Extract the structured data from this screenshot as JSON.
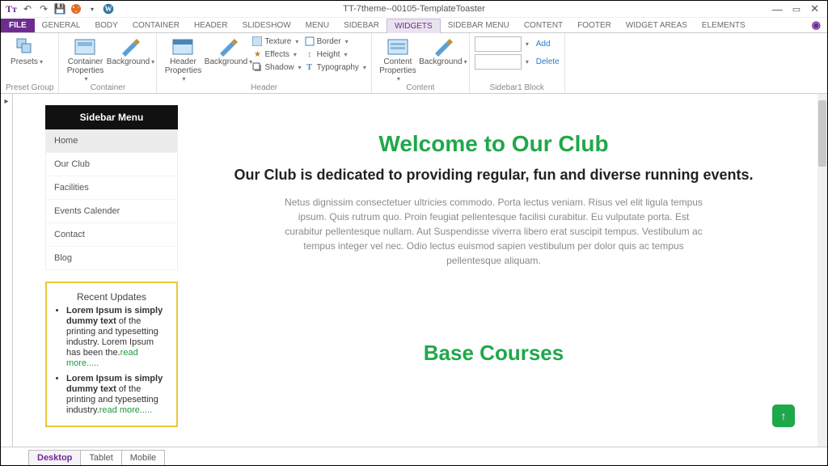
{
  "title": "TT-7theme--00105-TemplateToaster",
  "tabs": {
    "file": "FILE",
    "items": [
      "GENERAL",
      "BODY",
      "CONTAINER",
      "HEADER",
      "SLIDESHOW",
      "MENU",
      "SIDEBAR",
      "WIDGETS",
      "SIDEBAR MENU",
      "CONTENT",
      "FOOTER",
      "WIDGET AREAS",
      "ELEMENTS"
    ],
    "active_index": 7
  },
  "ribbon": {
    "preset_group": {
      "label": "Preset Group",
      "presets": "Presets"
    },
    "container": {
      "label": "Container",
      "props": "Container\nProperties",
      "bg": "Background"
    },
    "header": {
      "label": "Header",
      "props": "Header\nProperties",
      "bg": "Background",
      "texture": "Texture",
      "effects": "Effects",
      "shadow": "Shadow",
      "border": "Border",
      "height": "Height",
      "typo": "Typography"
    },
    "content": {
      "label": "Content",
      "props": "Content\nProperties",
      "bg": "Background"
    },
    "sidebar": {
      "label": "Sidebar1 Block",
      "add": "Add",
      "delete": "Delete"
    }
  },
  "sidebar_menu": {
    "title": "Sidebar Menu",
    "items": [
      "Home",
      "Our Club",
      "Facilities",
      "Events Calender",
      "Contact",
      "Blog"
    ]
  },
  "recent_updates": {
    "title": "Recent Updates",
    "items": [
      {
        "bold": "Lorem Ipsum is simply dummy text",
        "rest": " of the printing and typesetting industry. Lorem Ipsum has been the.",
        "link": "read more....."
      },
      {
        "bold": "Lorem Ipsum is simply dummy text",
        "rest": " of the printing and typesetting industry.",
        "link": "read more....."
      }
    ]
  },
  "page": {
    "h1": "Welcome to Our Club",
    "h2": "Our Club is dedicated to providing regular, fun and diverse running events.",
    "body": "Netus dignissim consectetuer ultricies commodo. Porta lectus veniam. Risus vel elit ligula tempus ipsum. Quis rutrum quo. Proin feugiat pellentesque facilisi curabitur. Eu vulputate porta. Est curabitur pellentesque nullam. Aut Suspendisse viverra libero erat suscipit tempus. Vestibulum ac tempus integer vel nec. Odio lectus euismod sapien vestibulum per dolor quis ac tempus pellentesque aliquam.",
    "sub": "Base Courses"
  },
  "footer_tabs": [
    "Desktop",
    "Tablet",
    "Mobile"
  ]
}
